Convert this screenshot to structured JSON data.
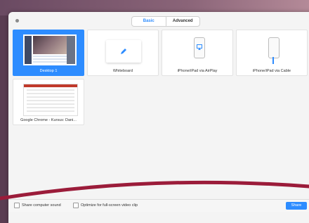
{
  "tabs": {
    "basic": "Basic",
    "advanced": "Advanced"
  },
  "items": [
    {
      "label": "Desktop 1",
      "selected": true
    },
    {
      "label": "Whiteboard"
    },
    {
      "label": "iPhone/iPad via AirPlay"
    },
    {
      "label": "iPhone/iPad via Cable"
    },
    {
      "label": "Google Chrome - Kursus: Dani..."
    }
  ],
  "footer": {
    "share_sound": "Share computer sound",
    "optimize": "Optimize for full-screen video clip",
    "share_button": "Share"
  },
  "colors": {
    "accent": "#2d8cff",
    "annotation": "#9b1c3a"
  }
}
